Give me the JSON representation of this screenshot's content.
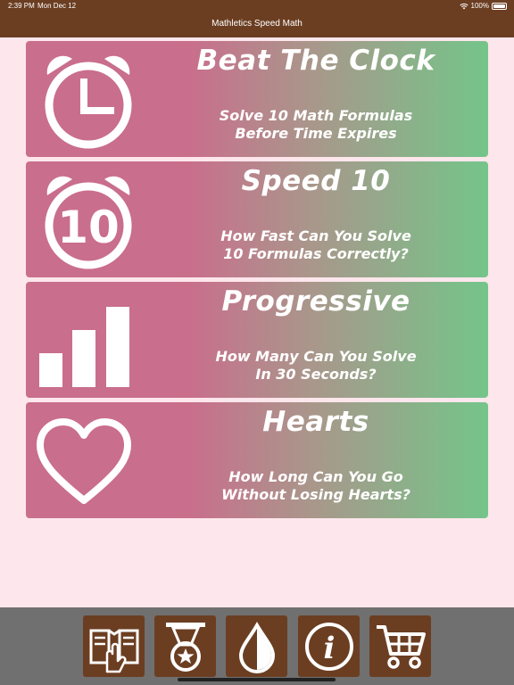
{
  "status_bar": {
    "time": "2:39 PM",
    "date": "Mon Dec 12",
    "battery": "100%"
  },
  "app": {
    "title": "Mathletics Speed Math"
  },
  "modes": [
    {
      "title": "Beat The Clock",
      "line1": "Solve 10 Math Formulas",
      "line2": "Before Time Expires",
      "icon": "alarm-clock-icon"
    },
    {
      "title": "Speed 10",
      "line1": "How Fast Can You Solve",
      "line2": "10 Formulas Correctly?",
      "icon": "alarm-clock-10-icon",
      "icon_text": "10"
    },
    {
      "title": "Progressive",
      "line1": "How Many Can You Solve",
      "line2": "In 30 Seconds?",
      "icon": "bar-chart-icon"
    },
    {
      "title": "Hearts",
      "line1": "How Long Can You Go",
      "line2": "Without Losing Hearts?",
      "icon": "heart-icon"
    }
  ],
  "toolbar": {
    "items": [
      {
        "name": "instructions",
        "icon": "book-hand-icon"
      },
      {
        "name": "achievements",
        "icon": "medal-icon"
      },
      {
        "name": "theme",
        "icon": "drop-icon"
      },
      {
        "name": "info",
        "icon": "info-icon",
        "glyph": "i"
      },
      {
        "name": "store",
        "icon": "cart-icon"
      }
    ]
  },
  "colors": {
    "header": "#6b3e22",
    "background": "#fde6ec",
    "card_left": "#c96e8c",
    "card_right": "#74c58a",
    "toolbar": "#707070"
  }
}
